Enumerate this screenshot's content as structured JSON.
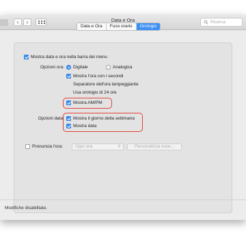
{
  "window": {
    "title": "Data e Ora"
  },
  "search": {
    "placeholder": "Ricerca"
  },
  "nav": {
    "back": "‹",
    "forward": "›"
  },
  "tabs": [
    {
      "label": "Data e Ora",
      "active": false
    },
    {
      "label": "Fuso orario",
      "active": false
    },
    {
      "label": "Orologio",
      "active": true
    }
  ],
  "clock": {
    "show_in_menubar": {
      "label": "Mostra data e ora nella barra dei menu",
      "checked": true
    },
    "time_options_label": "Opzioni ora:",
    "digital": {
      "label": "Digitale",
      "selected": true
    },
    "analog": {
      "label": "Analogica",
      "selected": false
    },
    "show_seconds": {
      "label": "Mostra l'ora con i secondi",
      "checked": true
    },
    "blink_separators": {
      "label": "Separatore dell'ora lampeggiante",
      "checked": false
    },
    "use_24h": {
      "label": "Usa orologio di 24 ore",
      "checked": false
    },
    "show_ampm": {
      "label": "Mostra AM/PM",
      "checked": true
    },
    "date_options_label": "Opzioni data:",
    "show_weekday": {
      "label": "Mostra il giorno della settimana",
      "checked": true
    },
    "show_date": {
      "label": "Mostra data",
      "checked": true
    },
    "announce_time": {
      "label": "Pronuncia l'ora:",
      "checked": false
    },
    "announce_interval": "Ogni ora",
    "customize_voice": "Personalizza voce..."
  },
  "footer": {
    "status": "Modifiche disabilitate."
  },
  "colors": {
    "accent": "#3d8ff5",
    "highlight": "#e0423a",
    "background": "#ececec"
  }
}
